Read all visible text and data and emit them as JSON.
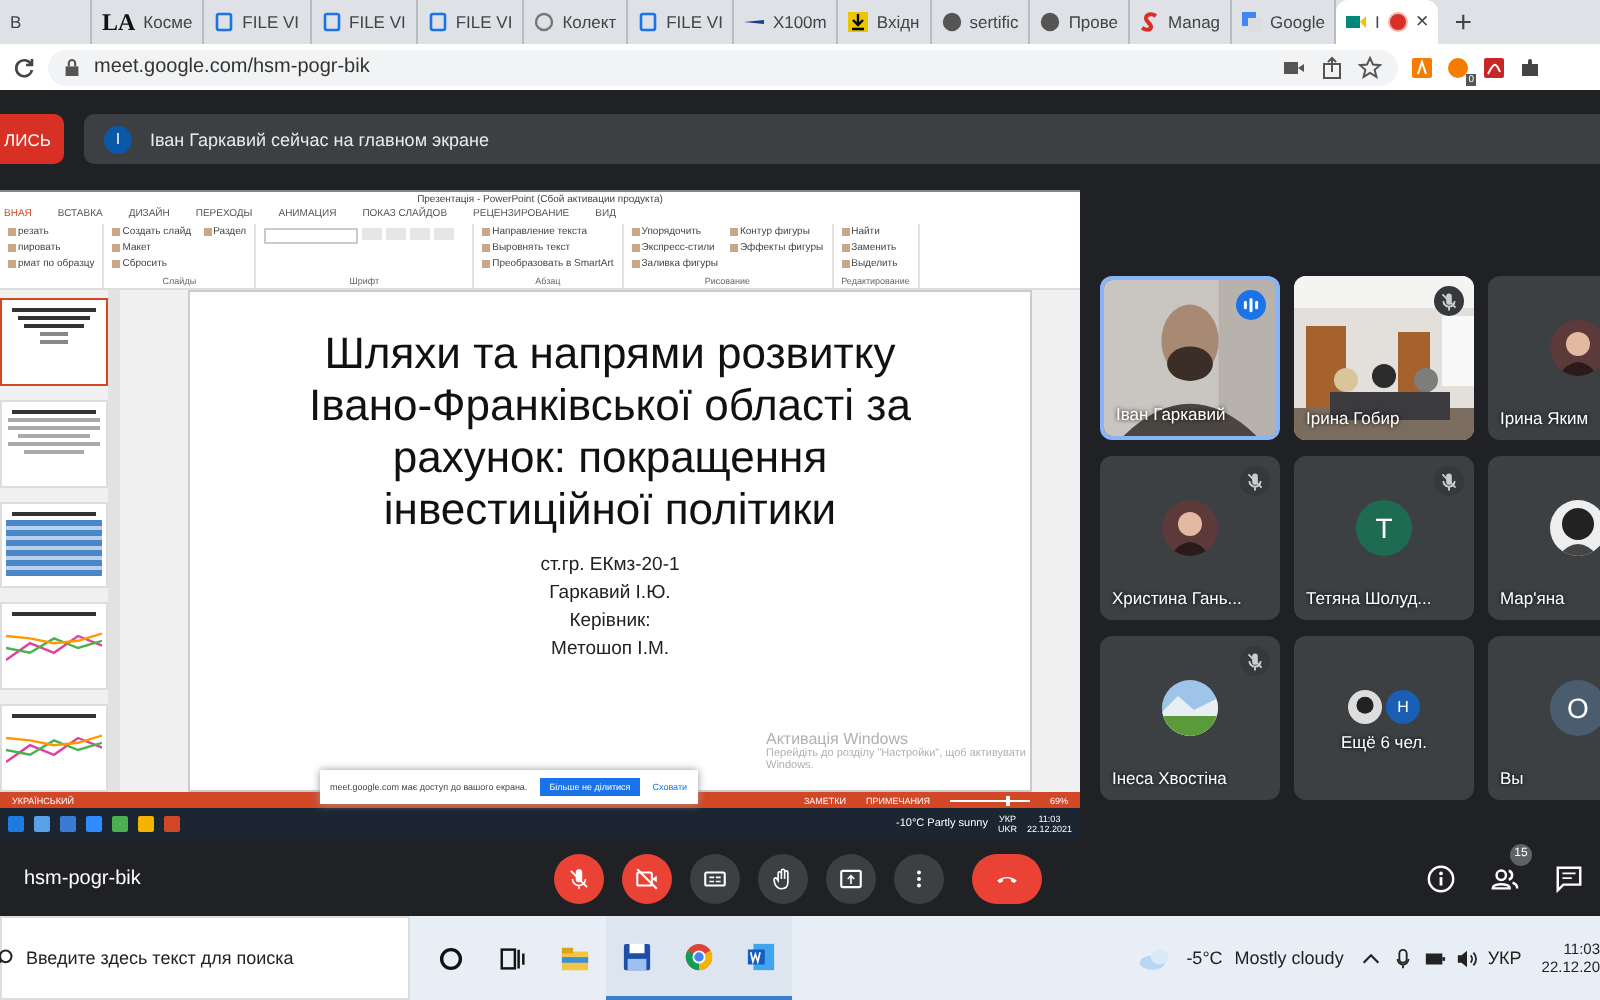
{
  "browser": {
    "tabs": [
      {
        "label": "B",
        "selected": false
      },
      {
        "logo": "LA",
        "label": "Косме",
        "selected": false
      },
      {
        "label": "FILE VI",
        "selected": false
      },
      {
        "label": "FILE VI",
        "selected": false
      },
      {
        "label": "FILE VI",
        "selected": false
      },
      {
        "label": "Колект",
        "selected": false
      },
      {
        "label": "FILE VI",
        "selected": false
      },
      {
        "label": "X100m",
        "selected": false
      },
      {
        "label": "Вхідн",
        "selected": false
      },
      {
        "label": "sertific",
        "selected": false
      },
      {
        "label": "Прове",
        "selected": false
      },
      {
        "label": "Manag",
        "selected": false
      },
      {
        "label": "Google",
        "selected": false
      },
      {
        "label": "I",
        "selected": true,
        "recording": true,
        "close": "×"
      }
    ],
    "new_tab": "+",
    "url": "meet.google.com/hsm-pogr-bik",
    "ext_badge": "0"
  },
  "meet": {
    "record_button": "ЛИСЬ",
    "banner": {
      "avatar": "І",
      "text": "Іван Гаркавий сейчас на главном экране"
    },
    "presentation": {
      "title": "Презентація - PowerPoint (Сбой активации продукта)",
      "tabs": [
        {
          "label": "ВНАЯ",
          "selected": true
        },
        {
          "label": "ВСТАВКА",
          "selected": false
        },
        {
          "label": "ДИЗАЙН",
          "selected": false
        },
        {
          "label": "ПЕРЕХОДЫ",
          "selected": false
        },
        {
          "label": "АНИМАЦИЯ",
          "selected": false
        },
        {
          "label": "ПОКАЗ СЛАЙДОВ",
          "selected": false
        },
        {
          "label": "РЕЦЕНЗИРОВАНИЕ",
          "selected": false
        },
        {
          "label": "ВИД",
          "selected": false
        }
      ],
      "ribbon": [
        {
          "items": [
            "резать",
            "пировать",
            "рмат по образцу"
          ]
        },
        {
          "label": "Слайды",
          "items": [
            "Создать слайд",
            "Макет",
            "Сбросить",
            "Раздел"
          ]
        },
        {
          "label": "Шрифт"
        },
        {
          "label": "Абзац",
          "items": [
            "Направление текста",
            "Выровнять текст",
            "Преобразовать в SmartArt"
          ]
        },
        {
          "label": "Рисование",
          "items": [
            "Упорядочить",
            "Экспресс-стили",
            "Заливка фигуры",
            "Контур фигуры",
            "Эффекты фигуры"
          ]
        },
        {
          "label": "Редактирование",
          "items": [
            "Найти",
            "Заменить",
            "Выделить"
          ]
        }
      ],
      "thumbnails": [
        {
          "kind": "title",
          "selected": true
        },
        {
          "kind": "text",
          "selected": false
        },
        {
          "kind": "table",
          "selected": false
        },
        {
          "kind": "chart",
          "selected": false
        },
        {
          "kind": "chart",
          "selected": false
        }
      ],
      "slide": {
        "title_lines": [
          "Шляхи та напрями розвитку",
          "Івано-Франківської області за",
          "рахунок: покращення",
          "інвестиційної політики"
        ],
        "lines": [
          "ст.гр. ЕКмз-20-1",
          "Гаркавий І.Ю.",
          "Керівник:",
          "Метошоп І.М."
        ]
      },
      "activation": {
        "title": "Активація Windows",
        "text": "Перейдіть до розділу \"Настройки\", щоб активувати Windows."
      },
      "share_bar": {
        "text": "meet.google.com має доступ до вашого екрана.",
        "stop": "Більше не ділитися",
        "hide": "Сховати"
      },
      "status": {
        "language": "УКРАЇНСЬКИЙ",
        "notes": "ЗАМЕТКИ",
        "comments": "ПРИМЕЧАНИЯ",
        "zoom": "69%",
        "zoom_slider": {
          "level": 0.69
        }
      },
      "taskbar": {
        "weather": "-10°C  Partly sunny",
        "lang": "УКР",
        "lang_sub": "UKR",
        "time": "11:03",
        "date": "22.12.2021"
      }
    },
    "participants": [
      {
        "name": "Іван Гаркавий",
        "kind": "video",
        "speaking": true,
        "muted": false
      },
      {
        "name": "Ірина Гобир",
        "kind": "video",
        "speaking": false,
        "muted": true
      },
      {
        "name": "Ірина Яким",
        "kind": "avatar",
        "speaking": false,
        "muted": false
      },
      {
        "name": "Христина Гань...",
        "kind": "avatar",
        "speaking": false,
        "muted": true
      },
      {
        "name": "Тетяна Шолуд...",
        "kind": "letter",
        "letter": "T",
        "color": "#1e6b52",
        "speaking": false,
        "muted": true
      },
      {
        "name": "Мар'яна",
        "kind": "avatar",
        "speaking": false,
        "muted": false
      },
      {
        "name": "Інеса Хвостіна",
        "kind": "avatar",
        "speaking": false,
        "muted": true
      },
      {
        "name": "Ещё 6 чел.",
        "kind": "more",
        "letter": "Н",
        "color": "#1a5fb4",
        "speaking": false,
        "muted": false
      },
      {
        "name": "Вы",
        "kind": "letter",
        "letter": "О",
        "color": "#4a5d6e",
        "speaking": false,
        "muted": false
      }
    ],
    "bar": {
      "code": "hsm-pogr-bik",
      "controls": [
        {
          "kind": "mic",
          "on": false
        },
        {
          "kind": "camera",
          "on": false
        },
        {
          "kind": "captions",
          "on": false
        },
        {
          "kind": "hand",
          "on": false
        },
        {
          "kind": "present",
          "on": false
        },
        {
          "kind": "more",
          "on": false
        },
        {
          "kind": "leave",
          "on": false
        }
      ],
      "people_count": "15"
    }
  },
  "taskbar": {
    "search_placeholder": "Введите здесь текст для поиска",
    "apps": [
      {
        "kind": "cortana",
        "open": false
      },
      {
        "kind": "taskview",
        "open": false
      },
      {
        "kind": "explorer",
        "open": false
      },
      {
        "kind": "floppy",
        "open": true
      },
      {
        "kind": "chrome",
        "open": true
      },
      {
        "kind": "word",
        "open": true
      }
    ],
    "weather": "-5°C",
    "condition": "Mostly cloudy",
    "lang": "УКР",
    "time": "11:03",
    "date": "22.12.20"
  }
}
